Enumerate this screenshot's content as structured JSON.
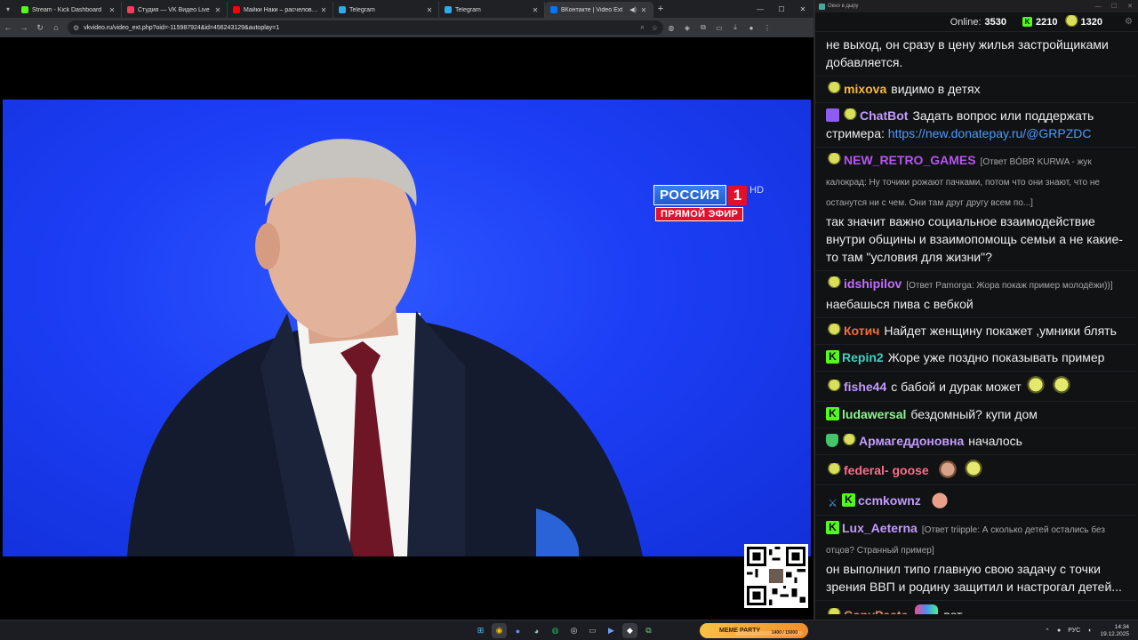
{
  "browser": {
    "tabs": [
      {
        "label": "Stream - Kick Dashboard",
        "color": "#53fc18"
      },
      {
        "label": "Студия — VK Видео Live",
        "color": "#ff3b5c"
      },
      {
        "label": "Майки Наки – расчеловечив…",
        "color": "#ff0000"
      },
      {
        "label": "Telegram",
        "color": "#2aabee"
      },
      {
        "label": "Telegram",
        "color": "#2aabee"
      },
      {
        "label": "ВКонтакте | Video Ext",
        "color": "#0077ff"
      }
    ],
    "url": "vkvideo.ru/video_ext.php?oid=-115987924&id=456243129&autoplay=1"
  },
  "video": {
    "channel_logo": "РОССИЯ",
    "channel_number": "1",
    "hd": "HD",
    "live_label": "ПРЯМОЙ ЭФИР"
  },
  "chat_window": {
    "title": "Окно в дыру",
    "online_label": "Online:",
    "online_count": "3530",
    "kick_count": "2210",
    "follower_count": "1320"
  },
  "messages": [
    {
      "name": "",
      "name_color": "#ffffff",
      "badges": [],
      "reply": "",
      "text": "не выход, он сразу в цену жилья застройщиками добавляется."
    },
    {
      "name": "mixova",
      "name_color": "#f5b93c",
      "badges": [
        "frog"
      ],
      "reply": "",
      "text": "видимо в детях"
    },
    {
      "name": "ChatBot",
      "name_color": "#c39bff",
      "badges": [
        "invader",
        "frog"
      ],
      "reply": "",
      "text": "Задать вопрос или поддержать стримера:",
      "link": "https://new.donatepay.ru/@GRPZDC"
    },
    {
      "name": "NEW_RETRO_GAMES",
      "name_color": "#b455f0",
      "badges": [
        "frog"
      ],
      "reply": "[Ответ BÓBR KURWA - жук калокрад: Ну точики рожают пачками, потом что они знают, что не останутся ни с чем. Они там друг другу всем по...]",
      "text": "так значит важно социальное взаимодействие внутри общины и взаимопомощь семьи а не какие-то там \"условия для жизни\"?"
    },
    {
      "name": "idshipilov",
      "name_color": "#c46bff",
      "badges": [
        "frog"
      ],
      "reply": "[Ответ Pamorga: Жора покаж пример молодёжи))]",
      "text": "наебашься пива с вебкой"
    },
    {
      "name": "Котич",
      "name_color": "#ef6f3b",
      "badges": [
        "frog"
      ],
      "reply": "",
      "text": "Найдет женщину покажет ,умники блять"
    },
    {
      "name": "Repin2",
      "name_color": "#3fd0c0",
      "badges": [
        "kick"
      ],
      "reply": "",
      "text": "Жоре уже поздно показывать пример"
    },
    {
      "name": "fishe44",
      "name_color": "#c39bff",
      "badges": [
        "frog"
      ],
      "reply": "",
      "text": "с бабой и дурак может",
      "emotes": [
        "pepe",
        "pepe"
      ]
    },
    {
      "name": "ludawersal",
      "name_color": "#8ef58e",
      "badges": [
        "kick"
      ],
      "reply": "",
      "text": "бездомный? купи дом"
    },
    {
      "name": "Армагеддоновна",
      "name_color": "#c39bff",
      "badges": [
        "shield",
        "frog"
      ],
      "reply": "",
      "text": "началось"
    },
    {
      "name": "federal- goose",
      "name_color": "#ff6b8a",
      "badges": [
        "frog"
      ],
      "reply": "",
      "text": "",
      "emotes": [
        "face",
        "pepe"
      ]
    },
    {
      "name": "ccmkownz",
      "name_color": "#c39bff",
      "badges": [
        "sword",
        "kick"
      ],
      "reply": "",
      "text": "",
      "emotes": [
        "bald"
      ]
    },
    {
      "name": "Lux_Aeterna",
      "name_color": "#c39bff",
      "badges": [
        "kick"
      ],
      "reply": "[Ответ triipple: А сколько детей остались без отцов? Странный пример]",
      "text": "он выполнил типо главную свою задачу с точки зрения ВВП и родину защитил и настрогал детей..."
    },
    {
      "name": "CopyPaste",
      "name_color": "#d98a6b",
      "badges": [
        "frog"
      ],
      "reply": "",
      "text": "вот",
      "emotes_before": [
        "rainbow"
      ]
    }
  ],
  "taskbar": {
    "meme_label": "MEME PARTY",
    "meme_count": "1400 / 15000",
    "lang": "РУС",
    "time": "14:34",
    "date": "19.12.2025"
  }
}
